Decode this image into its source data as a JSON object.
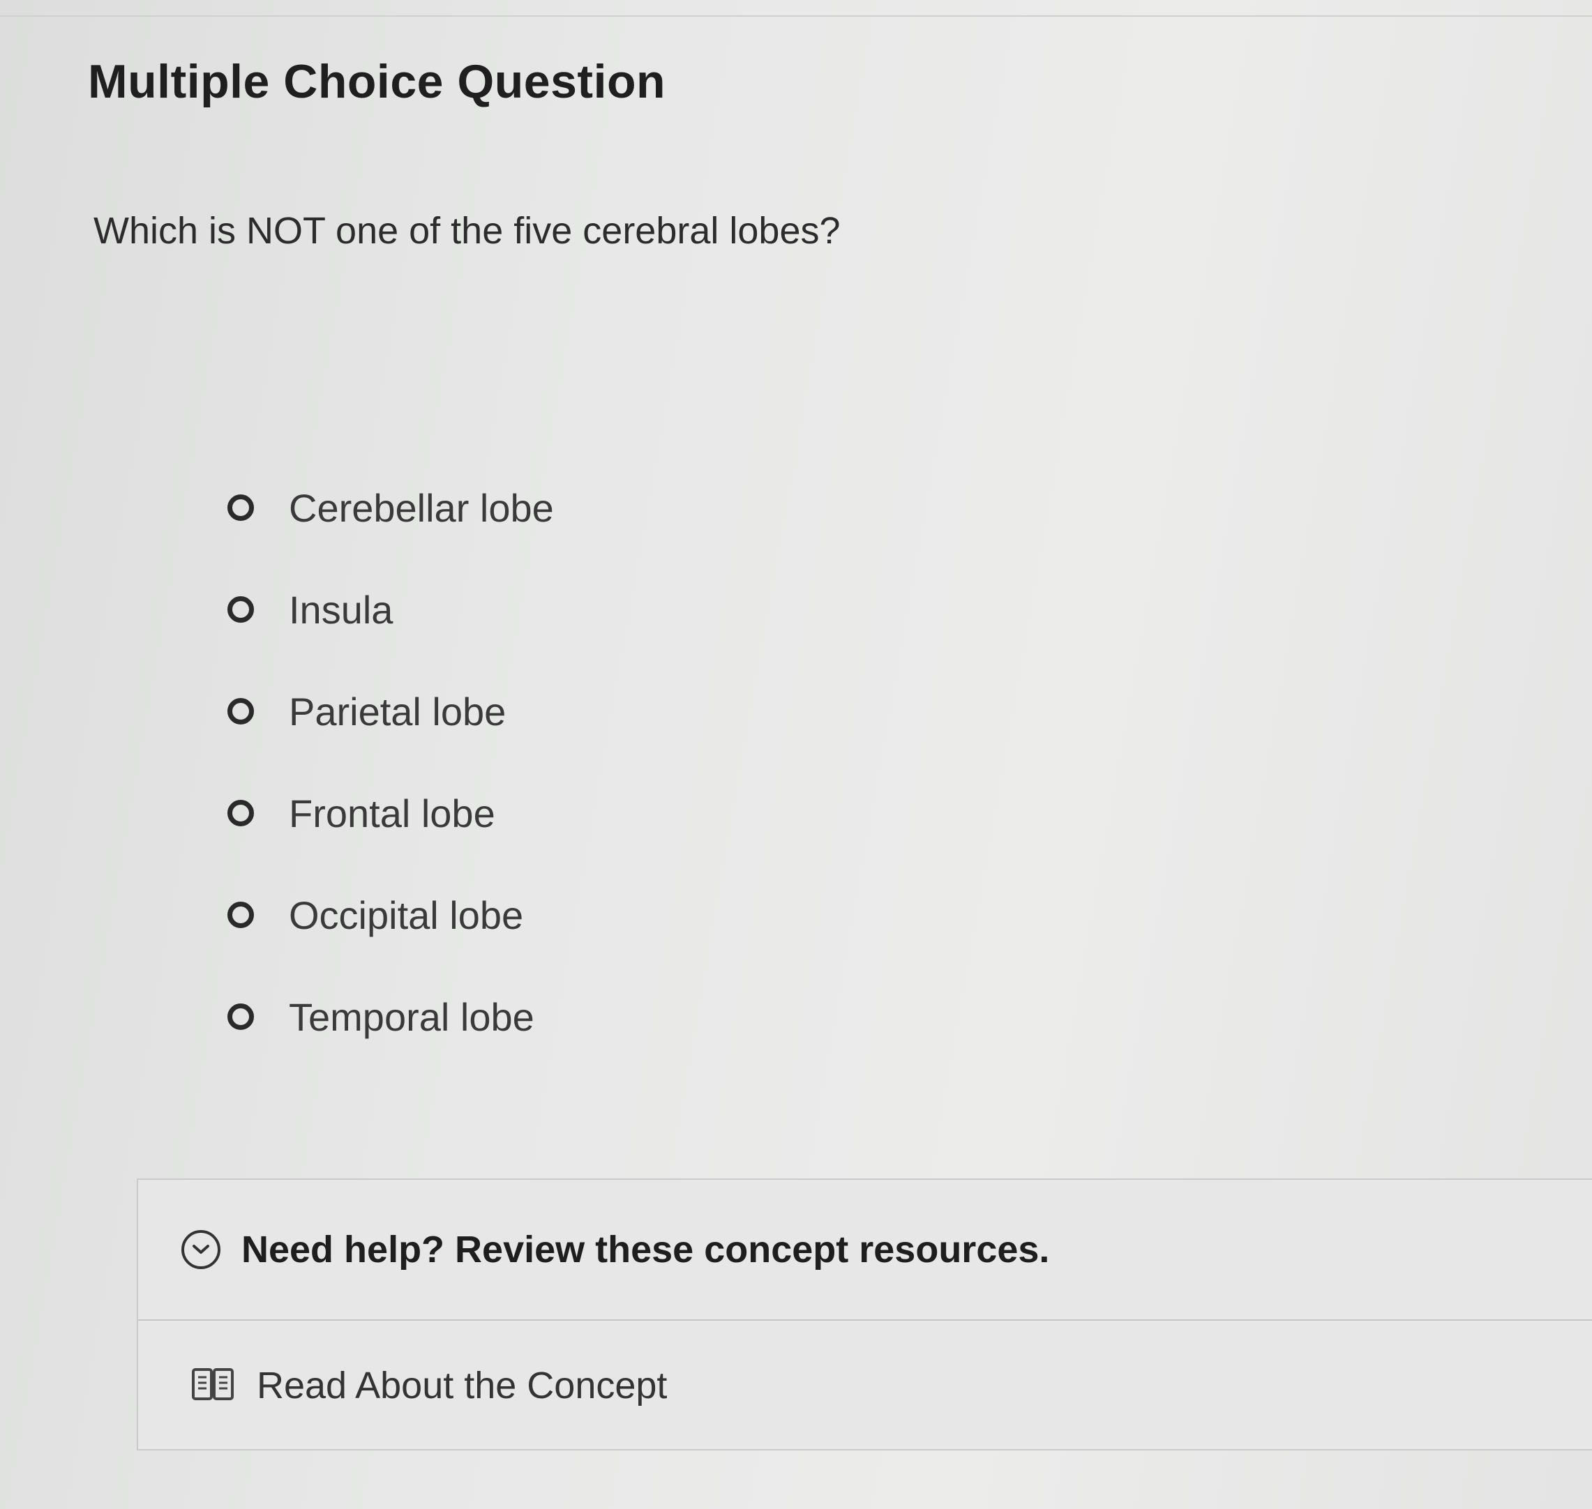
{
  "question": {
    "type_label": "Multiple Choice Question",
    "prompt": "Which is NOT one of the five cerebral lobes?",
    "choices": [
      {
        "label": "Cerebellar lobe"
      },
      {
        "label": "Insula"
      },
      {
        "label": "Parietal lobe"
      },
      {
        "label": "Frontal lobe"
      },
      {
        "label": "Occipital lobe"
      },
      {
        "label": "Temporal lobe"
      }
    ]
  },
  "help": {
    "title": "Need help? Review these concept resources.",
    "resources": [
      {
        "label": "Read About the Concept",
        "icon": "book-icon"
      }
    ]
  }
}
